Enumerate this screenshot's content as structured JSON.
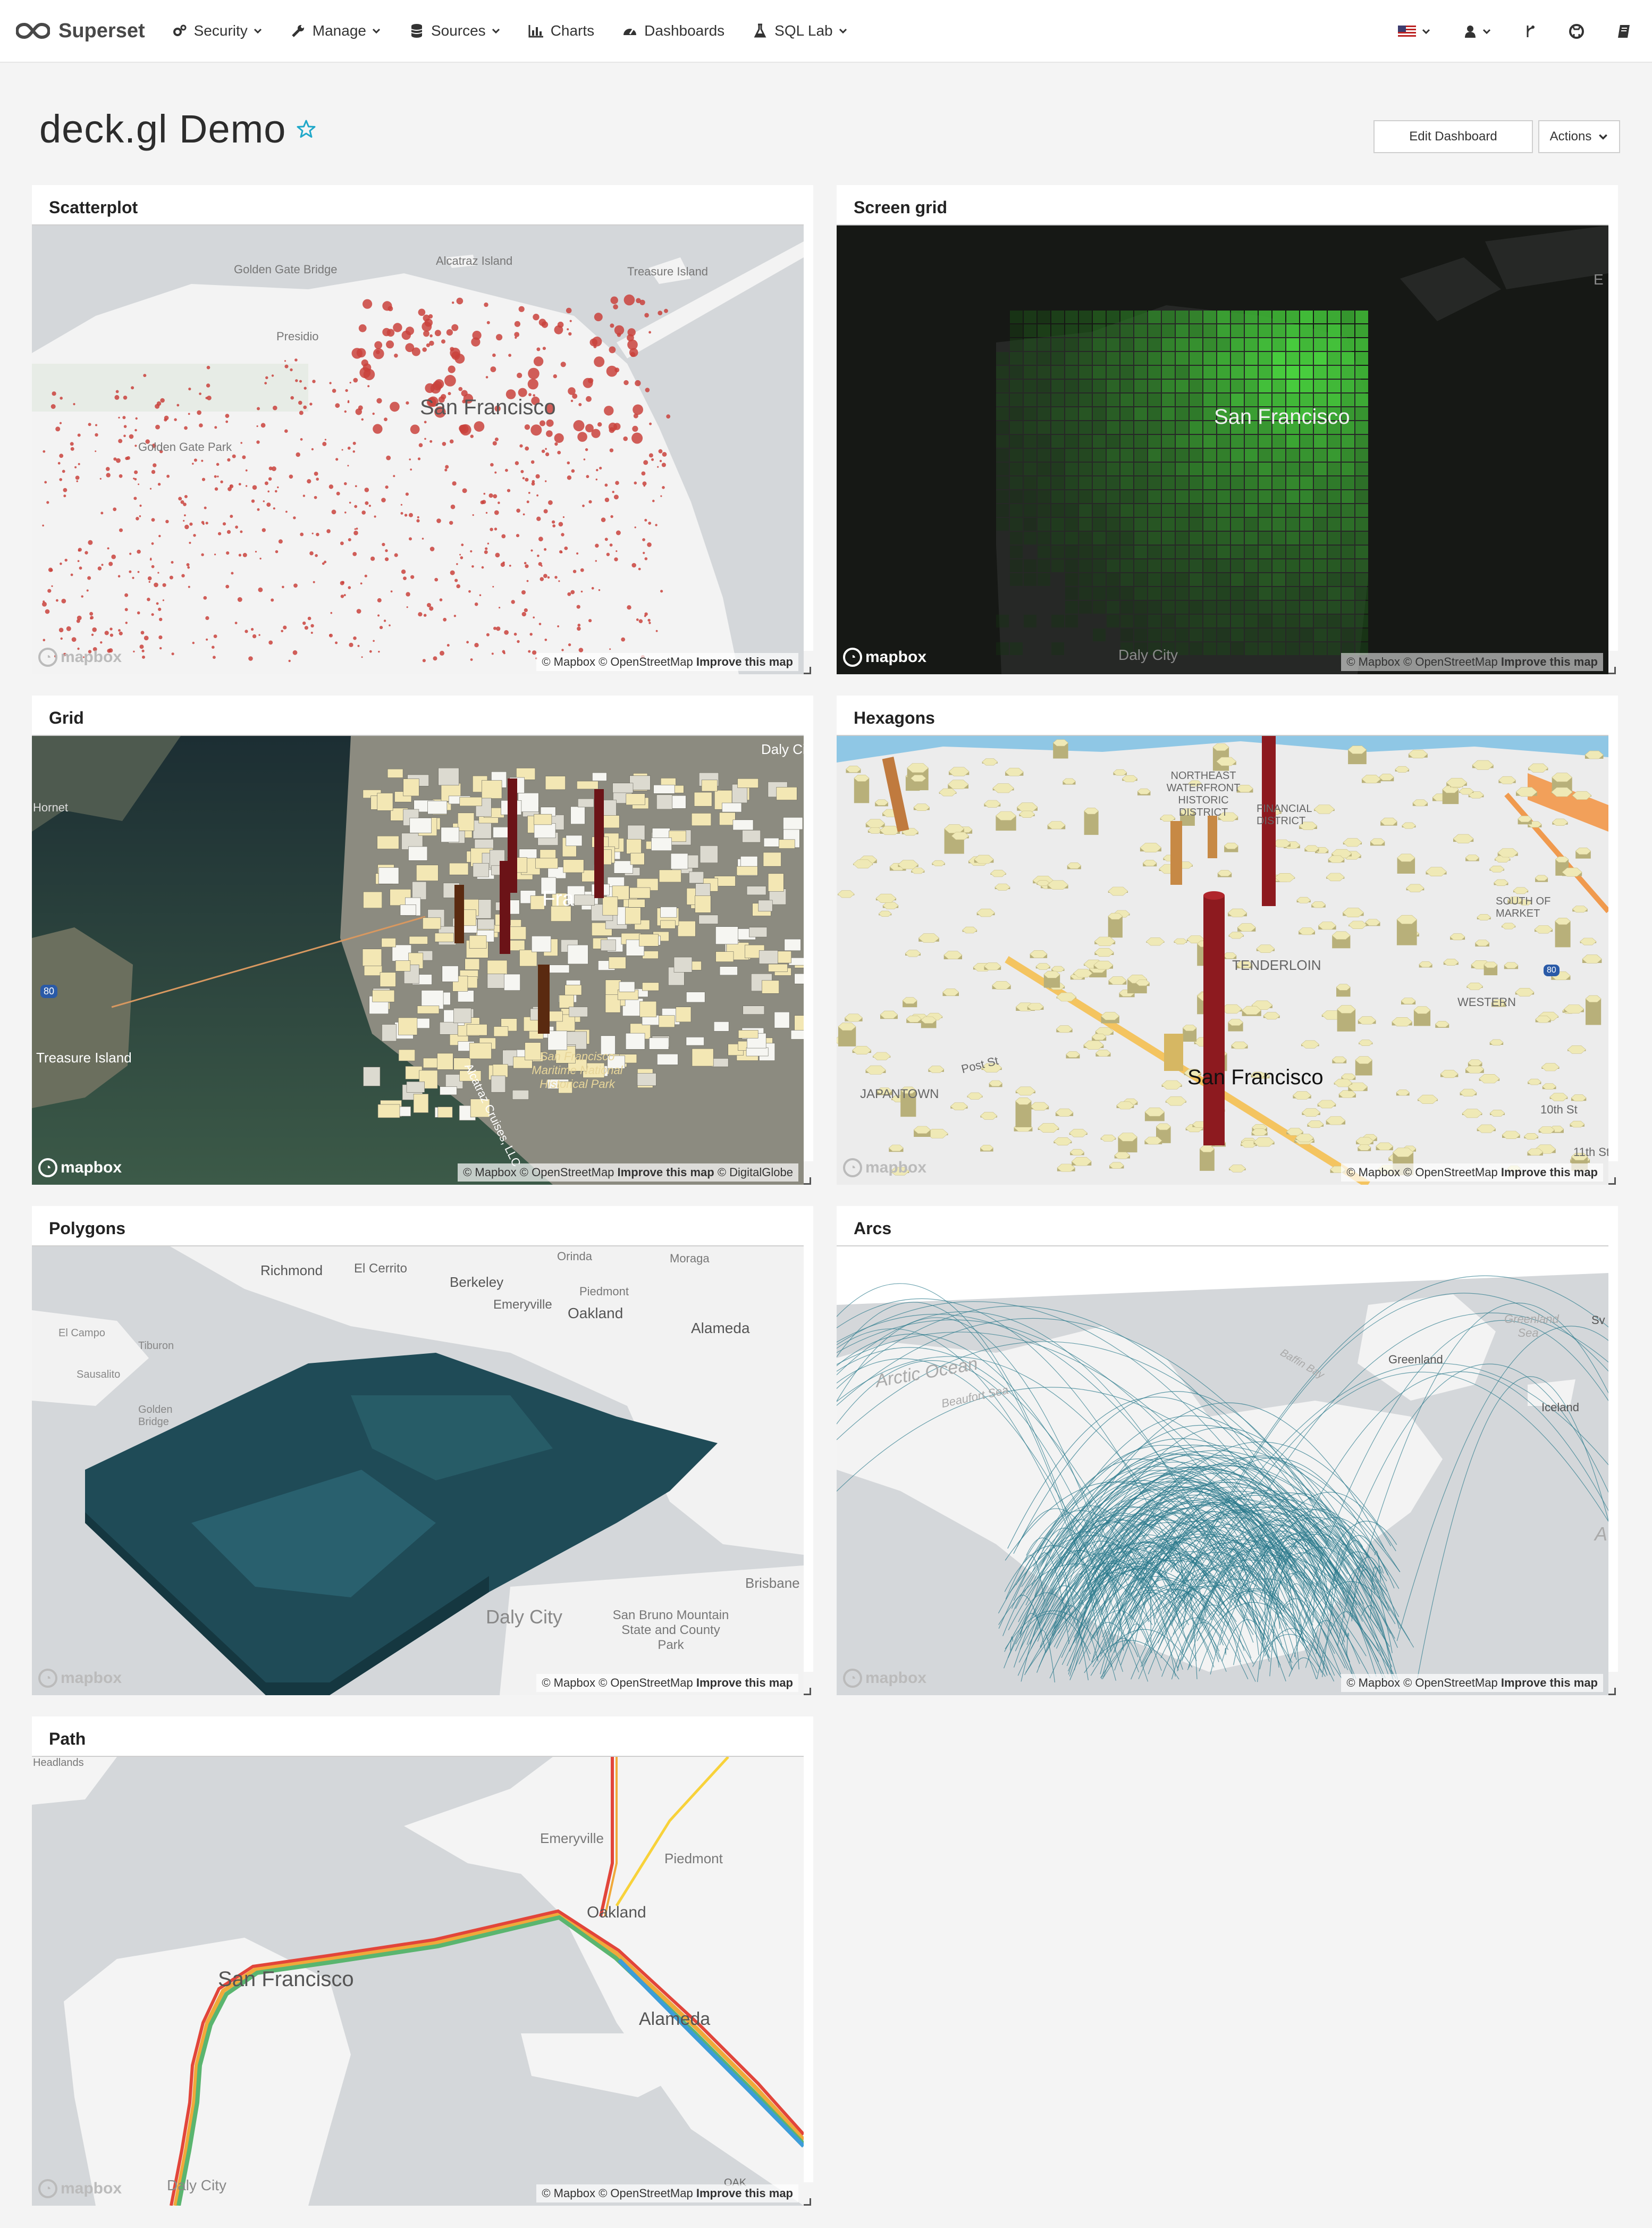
{
  "navbar": {
    "brand": "Superset",
    "items": [
      {
        "label": "Security",
        "icon": "gears-icon",
        "dropdown": true
      },
      {
        "label": "Manage",
        "icon": "wrench-icon",
        "dropdown": true
      },
      {
        "label": "Sources",
        "icon": "database-icon",
        "dropdown": true
      },
      {
        "label": "Charts",
        "icon": "bar-chart-icon",
        "dropdown": false
      },
      {
        "label": "Dashboards",
        "icon": "dashboard-icon",
        "dropdown": false
      },
      {
        "label": "SQL Lab",
        "icon": "flask-icon",
        "dropdown": true
      }
    ],
    "right_icons": [
      "us-flag-icon",
      "user-icon",
      "git-branch-icon",
      "github-icon",
      "book-icon"
    ]
  },
  "header": {
    "title": "deck.gl Demo",
    "edit_button": "Edit Dashboard",
    "actions_button": "Actions"
  },
  "attribution": {
    "mapbox": "© Mapbox",
    "osm": "© OpenStreetMap",
    "improve": "Improve this map",
    "digitalglobe": "© DigitalGlobe",
    "logo_text": "mapbox"
  },
  "panels": [
    {
      "title": "Scatterplot",
      "labels": [
        "Golden Gate Bridge",
        "Alcatraz Island",
        "Treasure Island",
        "Presidio",
        "Golden Gate Park",
        "San Francisco"
      ]
    },
    {
      "title": "Screen grid",
      "labels": [
        "San Francisco",
        "Daly City",
        "E"
      ]
    },
    {
      "title": "Grid",
      "labels": [
        "Hornet",
        "Treasure Island",
        "80",
        "San Francisco Maritime National Historical Park",
        "Alcatraz Cruises, LLC",
        "Daly Ci",
        "Fra"
      ]
    },
    {
      "title": "Hexagons",
      "labels": [
        "NORTHEAST WATERFRONT HISTORIC DISTRICT",
        "FINANCIAL DISTRICT",
        "SOUTH OF MARKET",
        "TENDERLOIN",
        "WESTERN",
        "JAPANTOWN",
        "San Francisco",
        "10th St",
        "11th St",
        "Post St",
        "80"
      ]
    },
    {
      "title": "Polygons",
      "labels": [
        "Richmond",
        "El Cerrito",
        "Orinda",
        "Moraga",
        "Berkeley",
        "Emeryville",
        "Piedmont",
        "Oakland",
        "Alameda",
        "El Campo",
        "Tiburon",
        "Sausalito",
        "Golden Bridge",
        "Brisbane",
        "Daly City",
        "San Bruno Mountain State and County Park"
      ]
    },
    {
      "title": "Arcs",
      "labels": [
        "Arctic Ocean",
        "Beaufort Sea",
        "Baffin Bay",
        "Greenland",
        "Greenland Sea",
        "Iceland",
        "A",
        "Sv"
      ]
    },
    {
      "title": "Path",
      "labels": [
        "Headlands",
        "Emeryville",
        "Piedmont",
        "Oakland",
        "San Francisco",
        "Alameda",
        "Daly City",
        "OAK"
      ]
    }
  ]
}
